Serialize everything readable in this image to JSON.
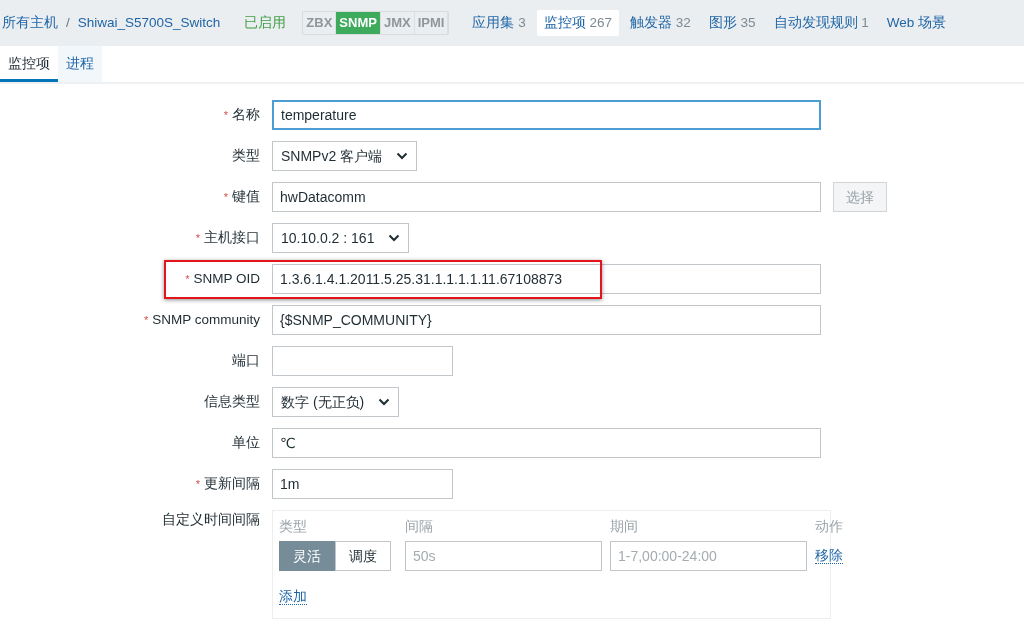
{
  "breadcrumb": {
    "items": [
      "所有主机",
      "Shiwai_S5700S_Switch"
    ],
    "separator": "/"
  },
  "required_mark": "*",
  "host_status": "已启用",
  "availability": [
    {
      "label": "ZBX",
      "on": false
    },
    {
      "label": "SNMP",
      "on": true
    },
    {
      "label": "JMX",
      "on": false
    },
    {
      "label": "IPMI",
      "on": false
    }
  ],
  "host_tabs": [
    {
      "label": "应用集",
      "count": "3",
      "selected": false
    },
    {
      "label": "监控项",
      "count": "267",
      "selected": true
    },
    {
      "label": "触发器",
      "count": "32",
      "selected": false
    },
    {
      "label": "图形",
      "count": "35",
      "selected": false
    },
    {
      "label": "自动发现规则",
      "count": "1",
      "selected": false
    },
    {
      "label": "Web 场景",
      "selected": false
    }
  ],
  "tabs": [
    {
      "label": "监控项",
      "selected": true
    },
    {
      "label": "进程",
      "selected": false
    }
  ],
  "fields": [
    {
      "label": "名称",
      "required": true,
      "kind": "text",
      "value": "temperature",
      "focused": true
    },
    {
      "label": "类型",
      "required": false,
      "kind": "select",
      "value": "SNMPv2 客户端"
    },
    {
      "label": "键值",
      "required": true,
      "kind": "text-button",
      "value": "hwDatacomm",
      "button": "选择",
      "button_disabled": true
    },
    {
      "label": "主机接口",
      "required": true,
      "kind": "select",
      "value": "10.10.0.2 : 161"
    },
    {
      "label": "SNMP OID",
      "required": true,
      "kind": "text",
      "value": "1.3.6.1.4.1.2011.5.25.31.1.1.1.1.11.67108873",
      "highlighted": true
    },
    {
      "label": "SNMP community",
      "required": true,
      "kind": "text",
      "value": "{$SNMP_COMMUNITY}"
    },
    {
      "label": "端口",
      "required": false,
      "kind": "short-text"
    },
    {
      "label": "信息类型",
      "required": false,
      "kind": "select",
      "value": "数字 (无正负)"
    },
    {
      "label": "单位",
      "required": false,
      "kind": "text",
      "value": "℃"
    },
    {
      "label": "更新间隔",
      "required": true,
      "kind": "short-text",
      "value": "1m"
    }
  ],
  "custom_intervals": {
    "label": "自定义时间间隔",
    "columns": [
      "类型",
      "间隔",
      "期间",
      "动作"
    ],
    "rows": [
      {
        "modes": [
          {
            "label": "灵活",
            "selected": true
          },
          {
            "label": "调度",
            "selected": false
          }
        ],
        "interval_placeholder": "50s",
        "period_placeholder": "1-7,00:00-24:00",
        "action": "移除"
      }
    ],
    "add": "添加"
  }
}
